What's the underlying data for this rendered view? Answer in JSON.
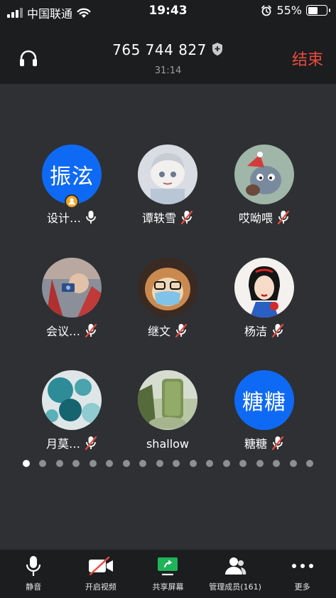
{
  "status_bar": {
    "carrier": "中国联通",
    "time": "19:43",
    "battery_percent": "55%",
    "battery_level": 0.55
  },
  "header": {
    "meeting_id": "765 744 827",
    "duration": "31:14",
    "end_label": "结束"
  },
  "participants": [
    {
      "name": "设计…",
      "avatar_text": "振泫",
      "mic": "on",
      "host": true
    },
    {
      "name": "谭轶雪",
      "mic": "muted"
    },
    {
      "name": "哎呦喂",
      "mic": "muted"
    },
    {
      "name": "会议…",
      "mic": "muted"
    },
    {
      "name": "继文",
      "mic": "muted"
    },
    {
      "name": "杨洁",
      "mic": "muted"
    },
    {
      "name": "月莫…",
      "mic": "muted"
    },
    {
      "name": "shallow",
      "mic": "none"
    },
    {
      "name": "糖糖",
      "avatar_text": "糖糖",
      "mic": "muted"
    }
  ],
  "pagination": {
    "total_pages": 18,
    "current_page": 1
  },
  "toolbar": {
    "mute": "静音",
    "video": "开启视频",
    "share": "共享屏幕",
    "members": "管理成员(161)",
    "more": "更多"
  },
  "colors": {
    "accent_blue": "#0e6af5",
    "end_red": "#e84a3f",
    "share_green": "#1fb35a",
    "host_badge": "#f6a623"
  }
}
